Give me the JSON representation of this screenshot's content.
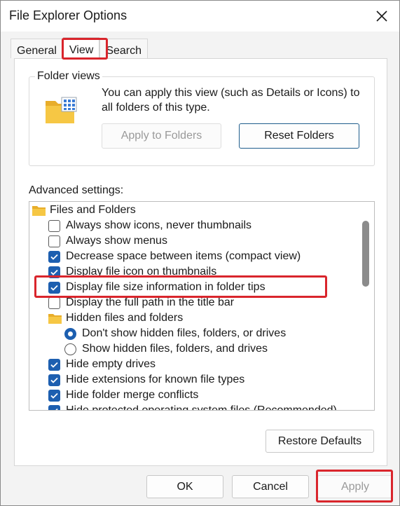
{
  "window": {
    "title": "File Explorer Options"
  },
  "tabs": [
    {
      "label": "General"
    },
    {
      "label": "View"
    },
    {
      "label": "Search"
    }
  ],
  "folder_views": {
    "legend": "Folder views",
    "description": "You can apply this view (such as Details or Icons) to all folders of this type.",
    "apply_label": "Apply to Folders",
    "reset_label": "Reset Folders"
  },
  "advanced": {
    "label": "Advanced settings:",
    "items": [
      {
        "kind": "folder",
        "label": "Files and Folders"
      },
      {
        "kind": "checkbox",
        "checked": false,
        "label": "Always show icons, never thumbnails"
      },
      {
        "kind": "checkbox",
        "checked": false,
        "label": "Always show menus"
      },
      {
        "kind": "checkbox",
        "checked": true,
        "label": "Decrease space between items (compact view)"
      },
      {
        "kind": "checkbox",
        "checked": true,
        "label": "Display file icon on thumbnails"
      },
      {
        "kind": "checkbox",
        "checked": true,
        "label": "Display file size information in folder tips"
      },
      {
        "kind": "checkbox",
        "checked": false,
        "label": "Display the full path in the title bar"
      },
      {
        "kind": "folder",
        "label": "Hidden files and folders"
      },
      {
        "kind": "radio",
        "selected": true,
        "label": "Don't show hidden files, folders, or drives"
      },
      {
        "kind": "radio",
        "selected": false,
        "label": "Show hidden files, folders, and drives"
      },
      {
        "kind": "checkbox",
        "checked": true,
        "label": "Hide empty drives"
      },
      {
        "kind": "checkbox",
        "checked": true,
        "label": "Hide extensions for known file types"
      },
      {
        "kind": "checkbox",
        "checked": true,
        "label": "Hide folder merge conflicts"
      },
      {
        "kind": "checkbox",
        "checked": true,
        "label": "Hide protected operating system files (Recommended)"
      }
    ]
  },
  "buttons": {
    "restore_defaults": "Restore Defaults",
    "ok": "OK",
    "cancel": "Cancel",
    "apply": "Apply"
  },
  "colors": {
    "highlight": "#d9252c",
    "accent": "#1d5fb0",
    "folder": "#f6c744"
  },
  "icons": [
    "close-icon",
    "folder-views-icon",
    "folder-icon",
    "checkmark-icon"
  ]
}
